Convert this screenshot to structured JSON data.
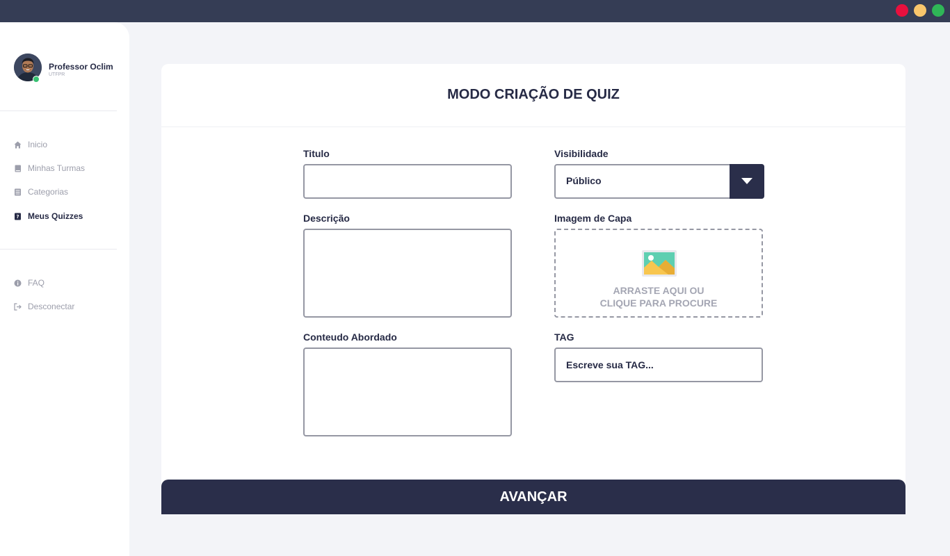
{
  "window": {
    "controls": [
      "close",
      "minimize",
      "maximize"
    ]
  },
  "profile": {
    "name": "Professor Oclim",
    "institution": "UTFPR",
    "status_color": "#38c172"
  },
  "nav": {
    "main": [
      {
        "label": "Inicio",
        "icon": "home-icon"
      },
      {
        "label": "Minhas Turmas",
        "icon": "book-icon"
      },
      {
        "label": "Categorias",
        "icon": "list-icon"
      },
      {
        "label": "Meus Quizzes",
        "icon": "quiz-icon",
        "active": true
      }
    ],
    "secondary": [
      {
        "label": "FAQ",
        "icon": "info-icon"
      },
      {
        "label": "Desconectar",
        "icon": "logout-icon"
      }
    ]
  },
  "form": {
    "title": "MODO CRIAÇÃO DE QUIZ",
    "titulo_label": "Titulo",
    "titulo_value": "",
    "descricao_label": "Descrição",
    "descricao_value": "",
    "conteudo_label": "Conteudo Abordado",
    "conteudo_value": "",
    "visibilidade_label": "Visibilidade",
    "visibilidade_value": "Público",
    "imagem_label": "Imagem de Capa",
    "imagem_text": "ARRASTE AQUI OU\nCLIQUE PARA PROCURE",
    "tag_label": "TAG",
    "tag_placeholder": "Escreve sua TAG...",
    "submit_label": "AVANÇAR"
  },
  "colors": {
    "primary": "#2a2e4a",
    "background": "#f3f4f8",
    "titlebar": "#353d55",
    "muted": "#9c9eab"
  }
}
